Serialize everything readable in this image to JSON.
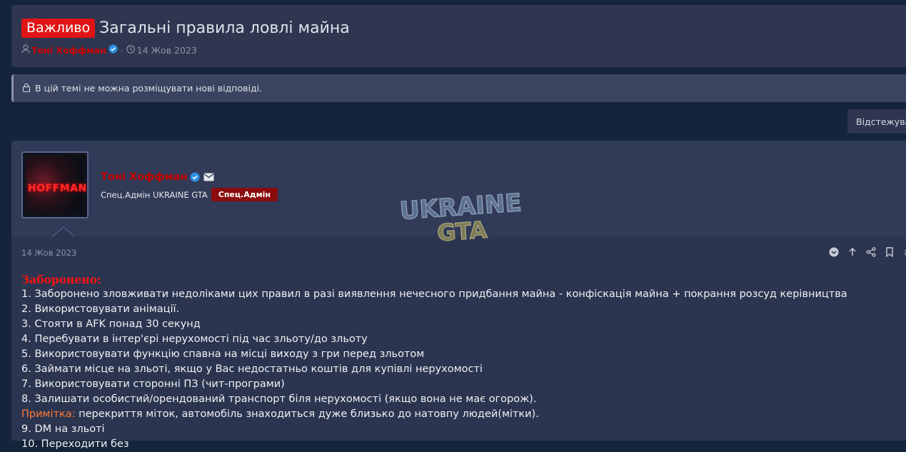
{
  "thread": {
    "prefix": "Важливо",
    "title": "Загальні правила ловлі майна",
    "author": "Тоні Хоффман",
    "separator": "·",
    "date": "14 Жов 2023"
  },
  "notice": {
    "text": "В цій темі не можна розміщувати нові відповіді."
  },
  "watch_button": {
    "label": "Відстежува"
  },
  "post": {
    "avatar_text": "HOFFMAN",
    "username": "Тоні Хоффман",
    "user_title": "Спец.Адмін UKRAINE GTA",
    "role_badge": "Спец.Адмін",
    "watermark_line1": "UKRAINE",
    "watermark_line2": "GTA",
    "date": "14 Жов 2023",
    "body": {
      "heading": "Заборонено:",
      "lines": [
        "1. Заборонено зловживати недоліками цих правил в разі виявлення нечесного придбання майна - конфіскація майна + покрання розсуд керівництва",
        "2. Використовувати анімації.",
        "3. Стояти в AFK понад 30 секунд",
        "4. Перебувати в інтер'єрі нерухомості під час зльоту/до зльоту",
        "5. Використовувати функцію спавна на місці виходу з гри перед зльотом",
        "6. Займати місце на зльоті, якщо у Вас недостатньо коштів для купівлі нерухомості",
        "7. Використовувати сторонні ПЗ (чит-програми)",
        "8. Залишати особистий/орендований транспорт біля нерухомості (якщо вона не має огорож)."
      ],
      "note_label": "Примітка:",
      "note_text": " перекриття міток, автомобіль знаходиться дуже близько до натовпу людей(мітки).",
      "line9": "9. DM на зльоті",
      "line10": "10. Переходити без"
    }
  },
  "colors": {
    "page_bg": "#14243a",
    "panel_bg": "#2e3650",
    "important_badge": "#e01414",
    "author_red": "#c80000",
    "role_badge": "#8a0c0c",
    "note_orange": "#ff7a30",
    "verified_blue": "#2b8ee6"
  }
}
